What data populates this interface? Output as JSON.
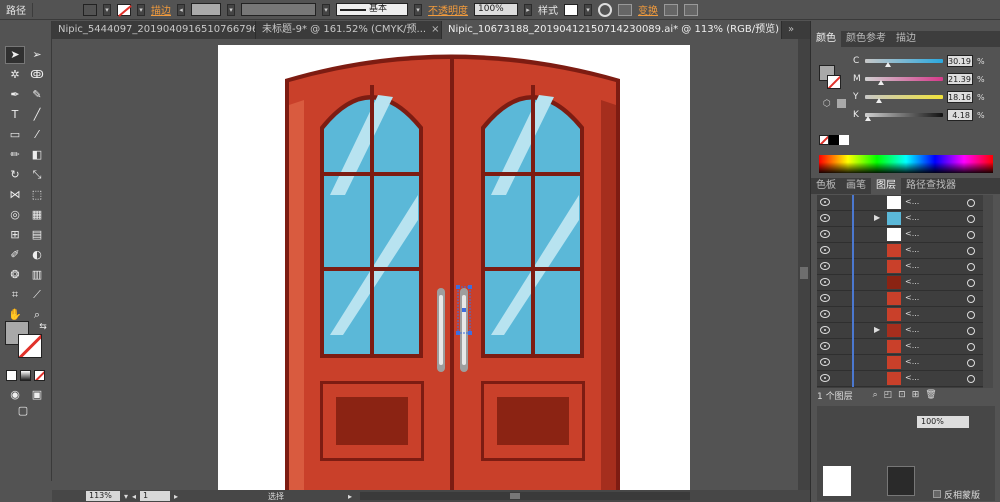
{
  "control_bar": {
    "object_type": "路径",
    "stroke_label": "描边",
    "stroke_profile": "基本",
    "opacity_label": "不透明度",
    "opacity_value": "100%",
    "style_label": "样式",
    "transform_label": "变换",
    "fill_color": "#a9a9a9",
    "stroke_color": "none"
  },
  "tabs": [
    {
      "label": "Nipic_5444097_20190409165107667964.ai*",
      "active": false
    },
    {
      "label": "未标题-9* @ 161.52% (CMYK/预...",
      "active": false
    },
    {
      "label": "Nipic_10673188_20190412150714230089.ai* @ 113% (RGB/预览)",
      "active": true
    }
  ],
  "color_panel": {
    "tabs": [
      "颜色",
      "颜色参考",
      "描边"
    ],
    "channels": [
      {
        "name": "C",
        "value": "30.19",
        "fraction": 0.3
      },
      {
        "name": "M",
        "value": "21.39",
        "fraction": 0.21
      },
      {
        "name": "Y",
        "value": "18.16",
        "fraction": 0.18
      },
      {
        "name": "K",
        "value": "4.18",
        "fraction": 0.04
      }
    ],
    "unit": "%"
  },
  "layers_panel": {
    "tabs": [
      "色板",
      "画笔",
      "图层",
      "路径查找器"
    ],
    "row_name": "<...",
    "count_label": "1 个图层",
    "rows": [
      {
        "thumb": "#ffffff",
        "arrow": false
      },
      {
        "thumb": "#5bb8d8",
        "arrow": true
      },
      {
        "thumb": "#ffffff",
        "arrow": false
      },
      {
        "thumb": "#c9402a",
        "arrow": false
      },
      {
        "thumb": "#c9402a",
        "arrow": false
      },
      {
        "thumb": "#8b2313",
        "arrow": false
      },
      {
        "thumb": "#c9402a",
        "arrow": false
      },
      {
        "thumb": "#c9402a",
        "arrow": false
      },
      {
        "thumb": "#a52e1d",
        "arrow": true
      },
      {
        "thumb": "#c9402a",
        "arrow": false
      },
      {
        "thumb": "#c9402a",
        "arrow": false
      },
      {
        "thumb": "#c9402a",
        "arrow": false
      }
    ]
  },
  "opacity_mask": {
    "opacity": "100%",
    "invert_mask": "反相蒙版"
  },
  "status_bar": {
    "zoom": "113%",
    "page": "1",
    "tool": "选择"
  },
  "artwork": {
    "frame": "#c9402a",
    "frame_dark": "#7d1c12",
    "glass": "#5bb8d8",
    "glass_highlight": "#b8e3f0",
    "handle": "#d8d8d8"
  }
}
